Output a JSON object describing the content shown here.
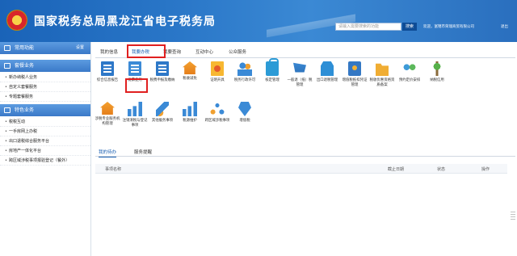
{
  "header": {
    "site_title": "国家税务总局黑龙江省电子税务局",
    "search_placeholder": "请输入需要搜索的功能",
    "search_button": "搜索",
    "welcome": "欢迎，富锦市荣瑞商贸有限公司",
    "exit_label": "退出"
  },
  "sidebar": {
    "common": {
      "label": "常用功能",
      "settings": "设置"
    },
    "package": {
      "label": "套餐业务",
      "items": [
        "新办纳税人业务",
        "自定义套餐服务",
        "专题套餐服务"
      ]
    },
    "special": {
      "label": "特色业务",
      "items": [
        "税税互动",
        "一手房网上办税",
        "出口退税综合服务平台",
        "房地产一体化平台",
        "跨区域涉税事项报验登记（餐外）"
      ]
    }
  },
  "main_tabs": [
    "我的信息",
    "我要办税",
    "我要查询",
    "互动中心",
    "公众服务"
  ],
  "tiles": [
    {
      "label": "综合信息报告",
      "icon": "doc-icon"
    },
    {
      "label": "发票使用",
      "icon": "invoice-icon"
    },
    {
      "label": "税费申报及缴纳",
      "icon": "doc-icon"
    },
    {
      "label": "税收减免",
      "icon": "house-icon"
    },
    {
      "label": "证明开具",
      "icon": "certificate-icon"
    },
    {
      "label": "税务行政许可",
      "icon": "people-icon"
    },
    {
      "label": "核定管理",
      "icon": "lock-icon"
    },
    {
      "label": "一般退（抵）税管理",
      "icon": "cart-icon"
    },
    {
      "label": "出口退税管理",
      "icon": "shop-icon"
    },
    {
      "label": "增值税抵扣凭证管理",
      "icon": "box-icon"
    },
    {
      "label": "税收优惠资格资质备案",
      "icon": "folder-icon"
    },
    {
      "label": "预约定价安排",
      "icon": "balloon-icon"
    },
    {
      "label": "纳税信用",
      "icon": "plant-icon"
    },
    {
      "label": "涉税专业服务机构管理",
      "icon": "house-icon"
    },
    {
      "label": "注销清税与登记事项",
      "icon": "bars-icon"
    },
    {
      "label": "其他服务事项",
      "icon": "pen-icon"
    },
    {
      "label": "税源维护",
      "icon": "bars-icon"
    },
    {
      "label": "跨区域涉税事项",
      "icon": "nodes-icon"
    },
    {
      "label": "增值税",
      "icon": "ribbon-icon"
    }
  ],
  "section_tabs": [
    "我的待办",
    "服务提醒"
  ],
  "table": {
    "columns": [
      "事项名称",
      "截止日期",
      "状态",
      "操作"
    ]
  }
}
